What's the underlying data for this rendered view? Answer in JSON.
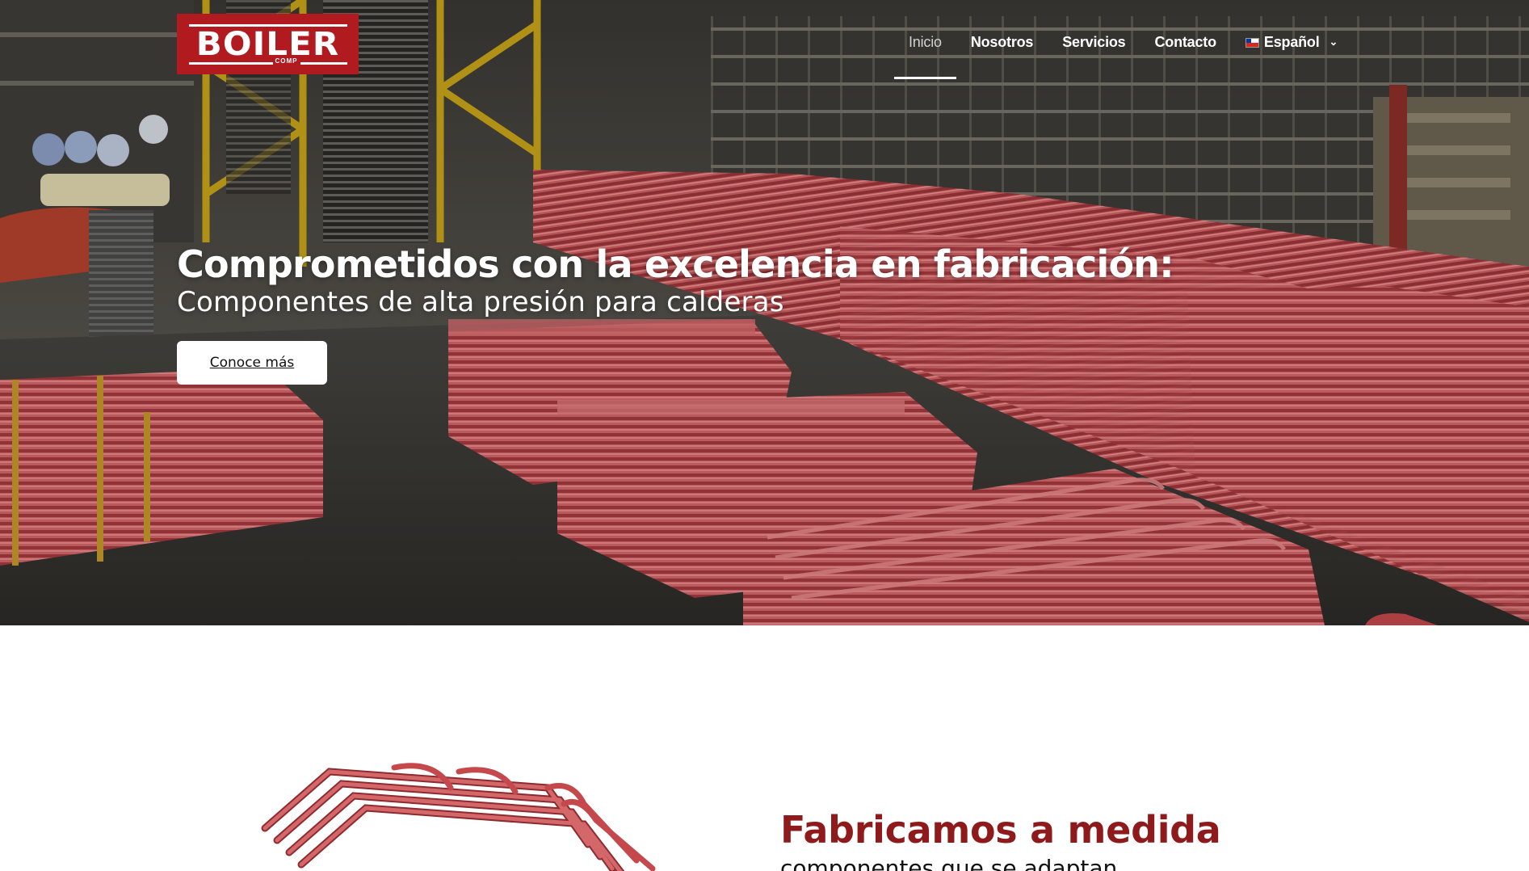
{
  "header": {
    "logo_text": "BOILER",
    "logo_sub": "COMP",
    "nav": [
      {
        "label": "Inicio",
        "active": true
      },
      {
        "label": "Nosotros",
        "active": false
      },
      {
        "label": "Servicios",
        "active": false
      },
      {
        "label": "Contacto",
        "active": false
      }
    ],
    "language": {
      "label": "Español",
      "flag": "chile-flag-icon",
      "icon": "chevron-down-icon"
    }
  },
  "hero": {
    "title": "Comprometidos con la excelencia en fabricación:",
    "subtitle": "Componentes de alta presión para calderas",
    "cta_label": "Conoce más"
  },
  "section": {
    "title": "Fabricamos a medida",
    "subtitle": "componentes que se adaptan"
  },
  "colors": {
    "brand_red": "#b11a1f",
    "title_red": "#8e1a1c",
    "tube_red": "#c4484c"
  }
}
